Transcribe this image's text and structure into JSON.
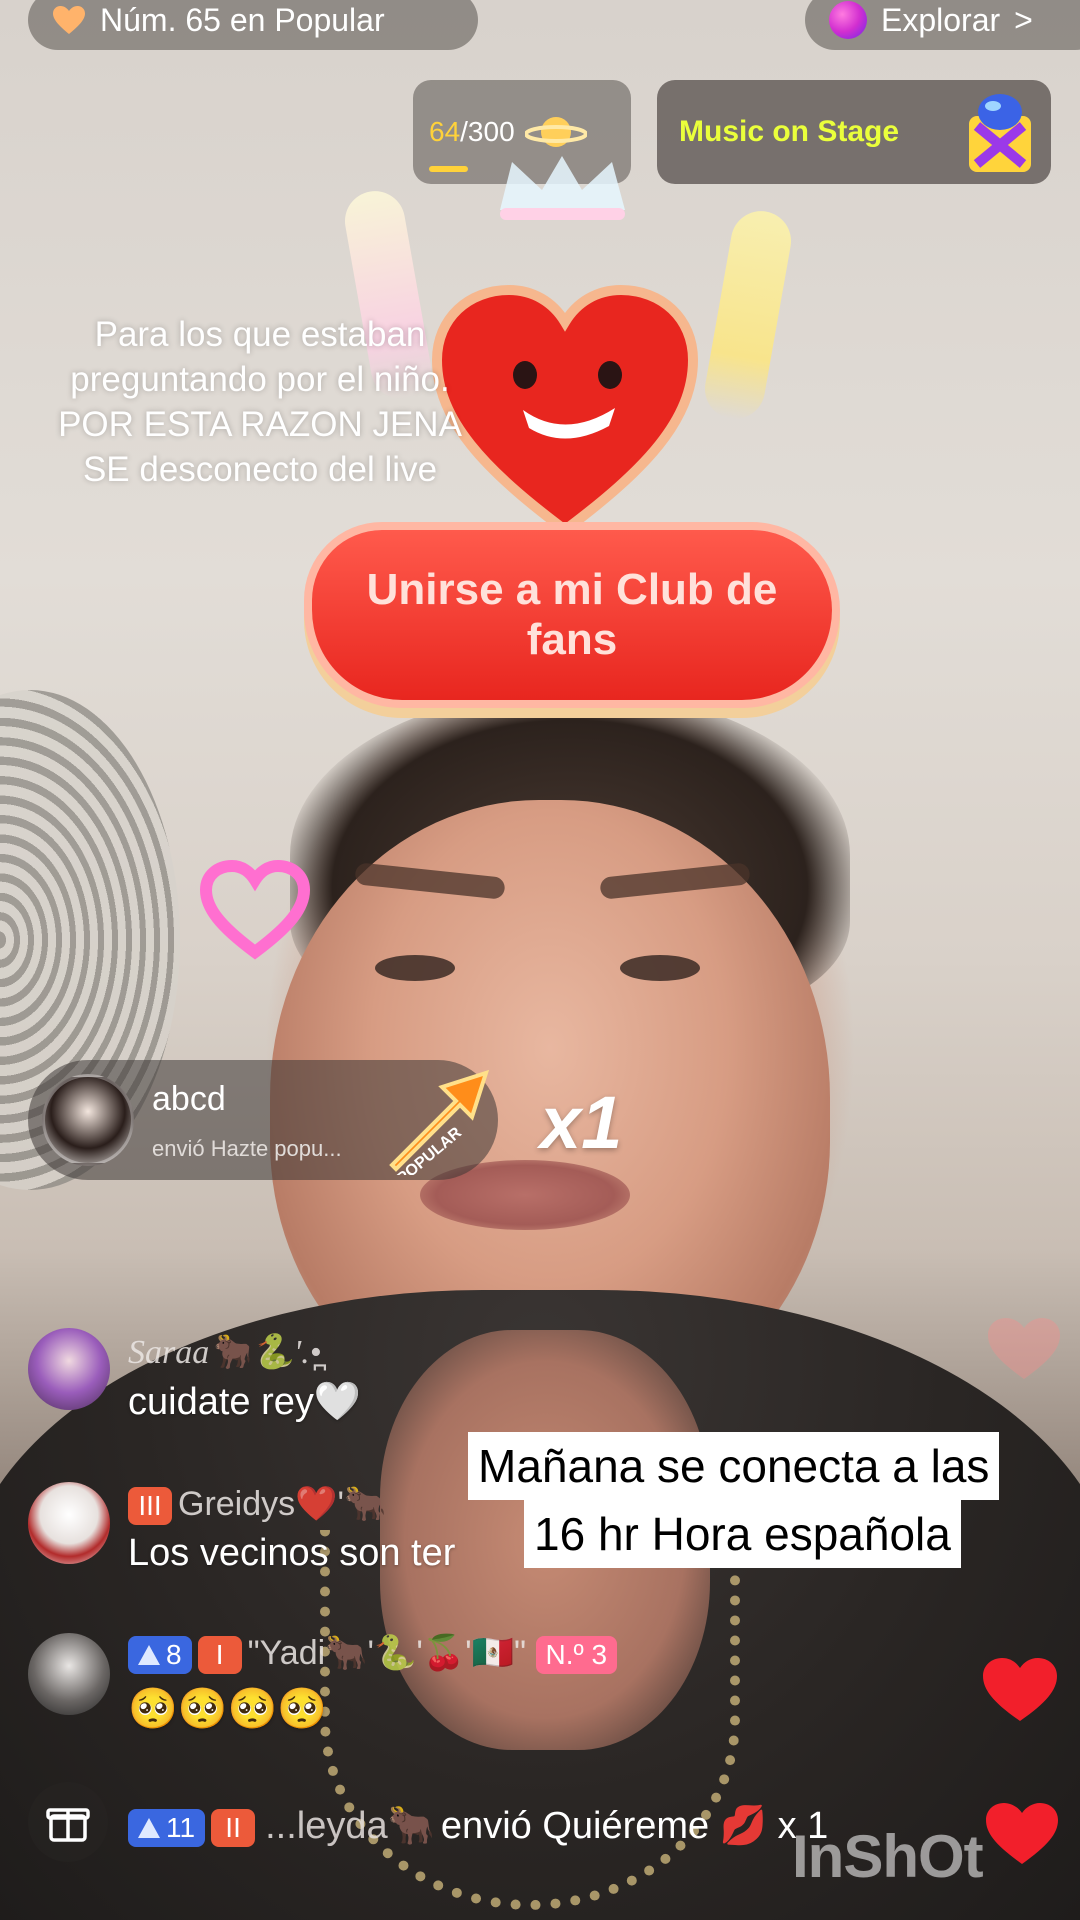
{
  "top_bar": {
    "popular_label": "Núm. 65 en Popular",
    "explore_label": "Explorar",
    "explore_chevron": ">"
  },
  "goal": {
    "current": "64",
    "total": "/300",
    "progress": 0.21
  },
  "stage": {
    "label": "Music on Stage"
  },
  "caption": {
    "lines": [
      "Para los que estaban",
      "preguntando por el niño.",
      "POR ESTA RAZON JENA",
      "SE desconecto del live"
    ]
  },
  "fan_club": {
    "label": "Unirse a mi Club de fans"
  },
  "gift_banner": {
    "username": "abcd",
    "text": "envió  Hazte popu...",
    "arrow_label": "POPULAR",
    "count": "x1"
  },
  "comments": [
    {
      "name": "Saraa🐂🐍'.•̪",
      "text": "cuidate rey🤍"
    },
    {
      "badge_level": "III",
      "name": "Greidys❤️'🐂",
      "text": "Los vecinos son ter"
    },
    {
      "badge_count": "8",
      "badge_level": "I",
      "name": "\"Yadi🐂'🐍'🍒'🇲🇽\"",
      "rank": "N.º 3",
      "text": "🥺🥺🥺🥺"
    }
  ],
  "notice": {
    "line1": "Mañana se conecta a las",
    "line2": "16 hr Hora española"
  },
  "bottom": {
    "badge_count": "11",
    "badge_level": "II",
    "who": "...leyda🐂",
    "text": "envió Quiéreme 💋 x 1"
  },
  "watermark": "InShOt",
  "colors": {
    "accent_yellow": "#eaff3b",
    "goal_yellow": "#ffd23a",
    "heart_red": "#e8261f",
    "badge_blue": "#3a67e0",
    "badge_orange": "#ec5a3a"
  }
}
